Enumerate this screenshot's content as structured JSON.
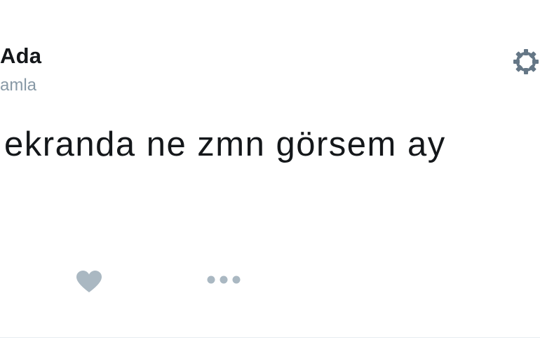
{
  "tweet": {
    "display_name": "Ada",
    "username": "amla",
    "text": "ekranda ne zmn görsem ay"
  },
  "icons": {
    "settings": "gear-icon",
    "like": "heart-icon",
    "more": "more-dots-icon"
  },
  "colors": {
    "text_primary": "#14171a",
    "text_secondary": "#8899a6",
    "icon_gray": "#aab8c2",
    "background": "#ffffff"
  }
}
